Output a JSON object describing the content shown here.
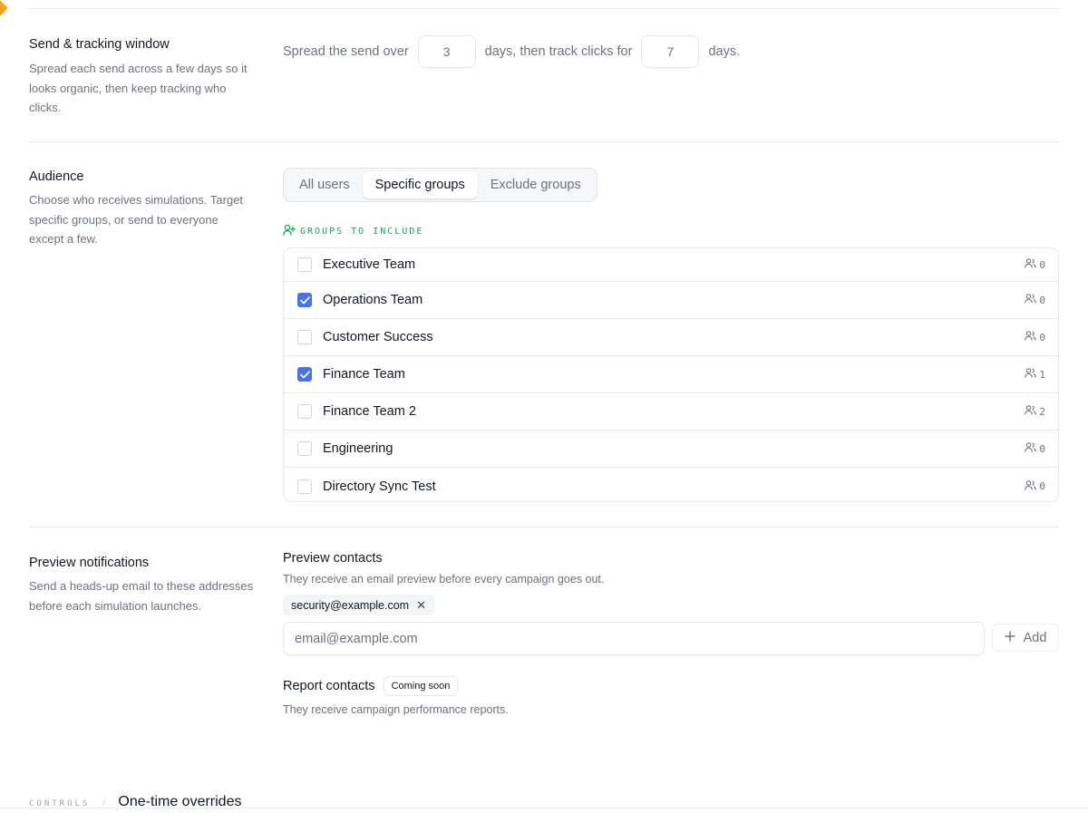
{
  "colors": {
    "accent": "#4a72e8",
    "green": "#16a34a",
    "corner": "#f5a623"
  },
  "send_window": {
    "title": "Send & tracking window",
    "description": "Spread each send across a few days so it looks organic, then keep tracking who clicks.",
    "prefix": "Spread the send over",
    "send_days": "3",
    "middle": "days, then track clicks for",
    "track_days": "7",
    "suffix": "days."
  },
  "audience": {
    "title": "Audience",
    "description": "Choose who receives simulations. Target specific groups, or send to everyone except a few.",
    "segments": [
      "All users",
      "Specific groups",
      "Exclude groups"
    ],
    "active_segment": "Specific groups",
    "groups_label": "GROUPS TO INCLUDE",
    "groups": [
      {
        "name": "Executive Team",
        "checked": false,
        "count": "0"
      },
      {
        "name": "Operations Team",
        "checked": true,
        "count": "0"
      },
      {
        "name": "Customer Success",
        "checked": false,
        "count": "0"
      },
      {
        "name": "Finance Team",
        "checked": true,
        "count": "1"
      },
      {
        "name": "Finance Team 2",
        "checked": false,
        "count": "2"
      },
      {
        "name": "Engineering",
        "checked": false,
        "count": "0"
      },
      {
        "name": "Directory Sync Test",
        "checked": false,
        "count": "0"
      }
    ]
  },
  "preview": {
    "title": "Preview notifications",
    "description": "Send a heads-up email to these addresses before each simulation launches.",
    "contacts_title": "Preview contacts",
    "contacts_desc": "They receive an email preview before every campaign goes out.",
    "chip": "security@example.com",
    "email_placeholder": "email@example.com",
    "add_label": "Add",
    "report_title": "Report contacts",
    "report_badge": "Coming soon",
    "report_desc": "They receive campaign performance reports."
  },
  "footer": {
    "controls": "CONTROLS",
    "separator": "/",
    "title": "One-time overrides"
  }
}
